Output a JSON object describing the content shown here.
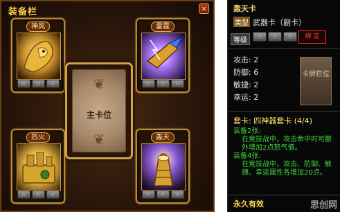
{
  "panel": {
    "title": "装备栏",
    "close": "×",
    "main_slot_label": "主卡位",
    "slots": [
      {
        "name": "神风",
        "stars": 3
      },
      {
        "name": "雷霆",
        "stars": 3
      },
      {
        "name": "烈火",
        "stars": 3
      },
      {
        "name": "轰天",
        "stars": 3
      }
    ],
    "star_glyph": "☆"
  },
  "tooltip": {
    "title": "轰天卡",
    "type_tag": "类型",
    "type_value": "武器卡（副卡）",
    "level_label": "等级",
    "badge": "绑 定",
    "stats": [
      "攻击: 2",
      "防御: 6",
      "敏捷: 2",
      "幸运: 2"
    ],
    "side_card": "卡牌栏位",
    "suit_title": "套卡: 四神器套卡  (4/4)",
    "suit_2_title": "装备2张:",
    "suit_2_text": "在竞技战中，攻击命中时可额外增加2点怒气值。",
    "suit_4_title": "装备4张:",
    "suit_4_text": "在竞技战中，攻击、防御、敏捷、幸运属性各增加20点。",
    "footer": "永久有效",
    "watermark": "思创网"
  },
  "colors": {
    "panel_bg": "#2a160a",
    "gold": "#d0a24a",
    "suit_green": "#3fd63f",
    "badge_red": "#ff3b3b"
  }
}
